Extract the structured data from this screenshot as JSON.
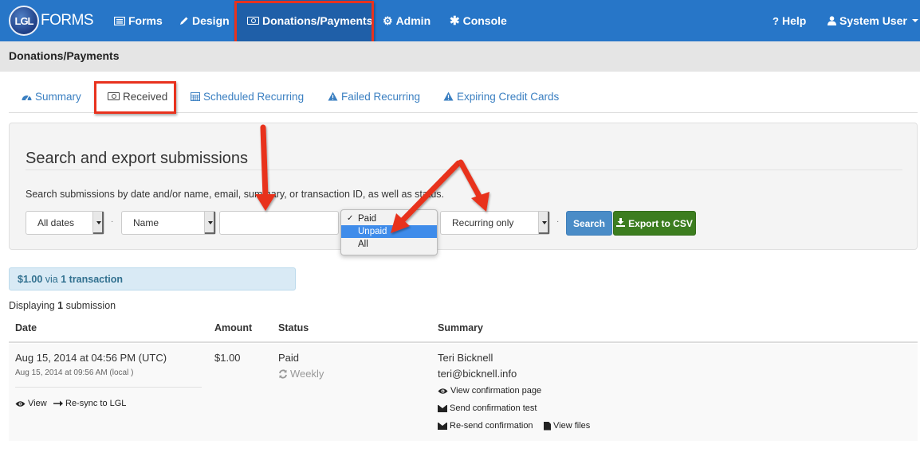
{
  "navbar": {
    "logo_mark": "LGL",
    "logo_text": "FORMS",
    "items": [
      {
        "label": "Forms",
        "icon": "list-icon"
      },
      {
        "label": "Design",
        "icon": "pencil-icon"
      },
      {
        "label": "Donations/Payments",
        "icon": "money-icon",
        "active": true
      },
      {
        "label": "Admin",
        "icon": "gear-icon"
      },
      {
        "label": "Console",
        "icon": "asterisk-icon"
      }
    ],
    "help_label": "Help",
    "help_icon": "?",
    "user_label": "System User",
    "user_icon": "user-icon"
  },
  "page_header": {
    "title": "Donations/Payments"
  },
  "tabs": [
    {
      "label": "Summary",
      "icon": "dashboard-icon"
    },
    {
      "label": "Received",
      "icon": "money-icon",
      "active": true
    },
    {
      "label": "Scheduled Recurring",
      "icon": "calendar-icon"
    },
    {
      "label": "Failed Recurring",
      "icon": "warning-icon"
    },
    {
      "label": "Expiring Credit Cards",
      "icon": "warning-icon"
    }
  ],
  "search": {
    "title": "Search and export submissions",
    "description": "Search submissions by date and/or name, email, summary, or transaction ID, as well as status.",
    "date_select": "All dates",
    "field_select": "Name",
    "query_value": "",
    "status_options": [
      {
        "label": "Paid",
        "checked": true
      },
      {
        "label": "Unpaid",
        "highlighted": true
      },
      {
        "label": "All"
      }
    ],
    "recurring_select": "Recurring only",
    "separator": "·",
    "search_label": "Search",
    "export_label": "Export to CSV"
  },
  "summary_alert": {
    "amount": "$1.00",
    "via": "via",
    "count": "1 transaction"
  },
  "displaying": {
    "prefix": "Displaying",
    "count": "1",
    "suffix": "submission"
  },
  "table": {
    "headers": [
      "Date",
      "Amount",
      "Status",
      "Summary"
    ],
    "rows": [
      {
        "date_utc": "Aug 15, 2014 at 04:56 PM (UTC)",
        "date_local": "Aug 15, 2014 at 09:56 AM (local )",
        "amount": "$1.00",
        "status": "Paid",
        "recurrence": "Weekly",
        "name": "Teri Bicknell",
        "email": "teri@bicknell.info",
        "actions": {
          "view": "View",
          "resync": "Re-sync to LGL",
          "view_confirmation": "View confirmation page",
          "send_test": "Send confirmation test",
          "resend": "Re-send confirmation",
          "view_files": "View files"
        }
      }
    ]
  },
  "colors": {
    "navbar": "#2776c8",
    "navbar_active": "#1f5fa8",
    "link": "#3a7fc1",
    "highlight_annotation": "#e8321e",
    "search_button": "#4a8cc7",
    "export_button": "#3c7d1f",
    "alert_bg": "#d9eaf5",
    "dropdown_selected": "#3f8cea"
  }
}
